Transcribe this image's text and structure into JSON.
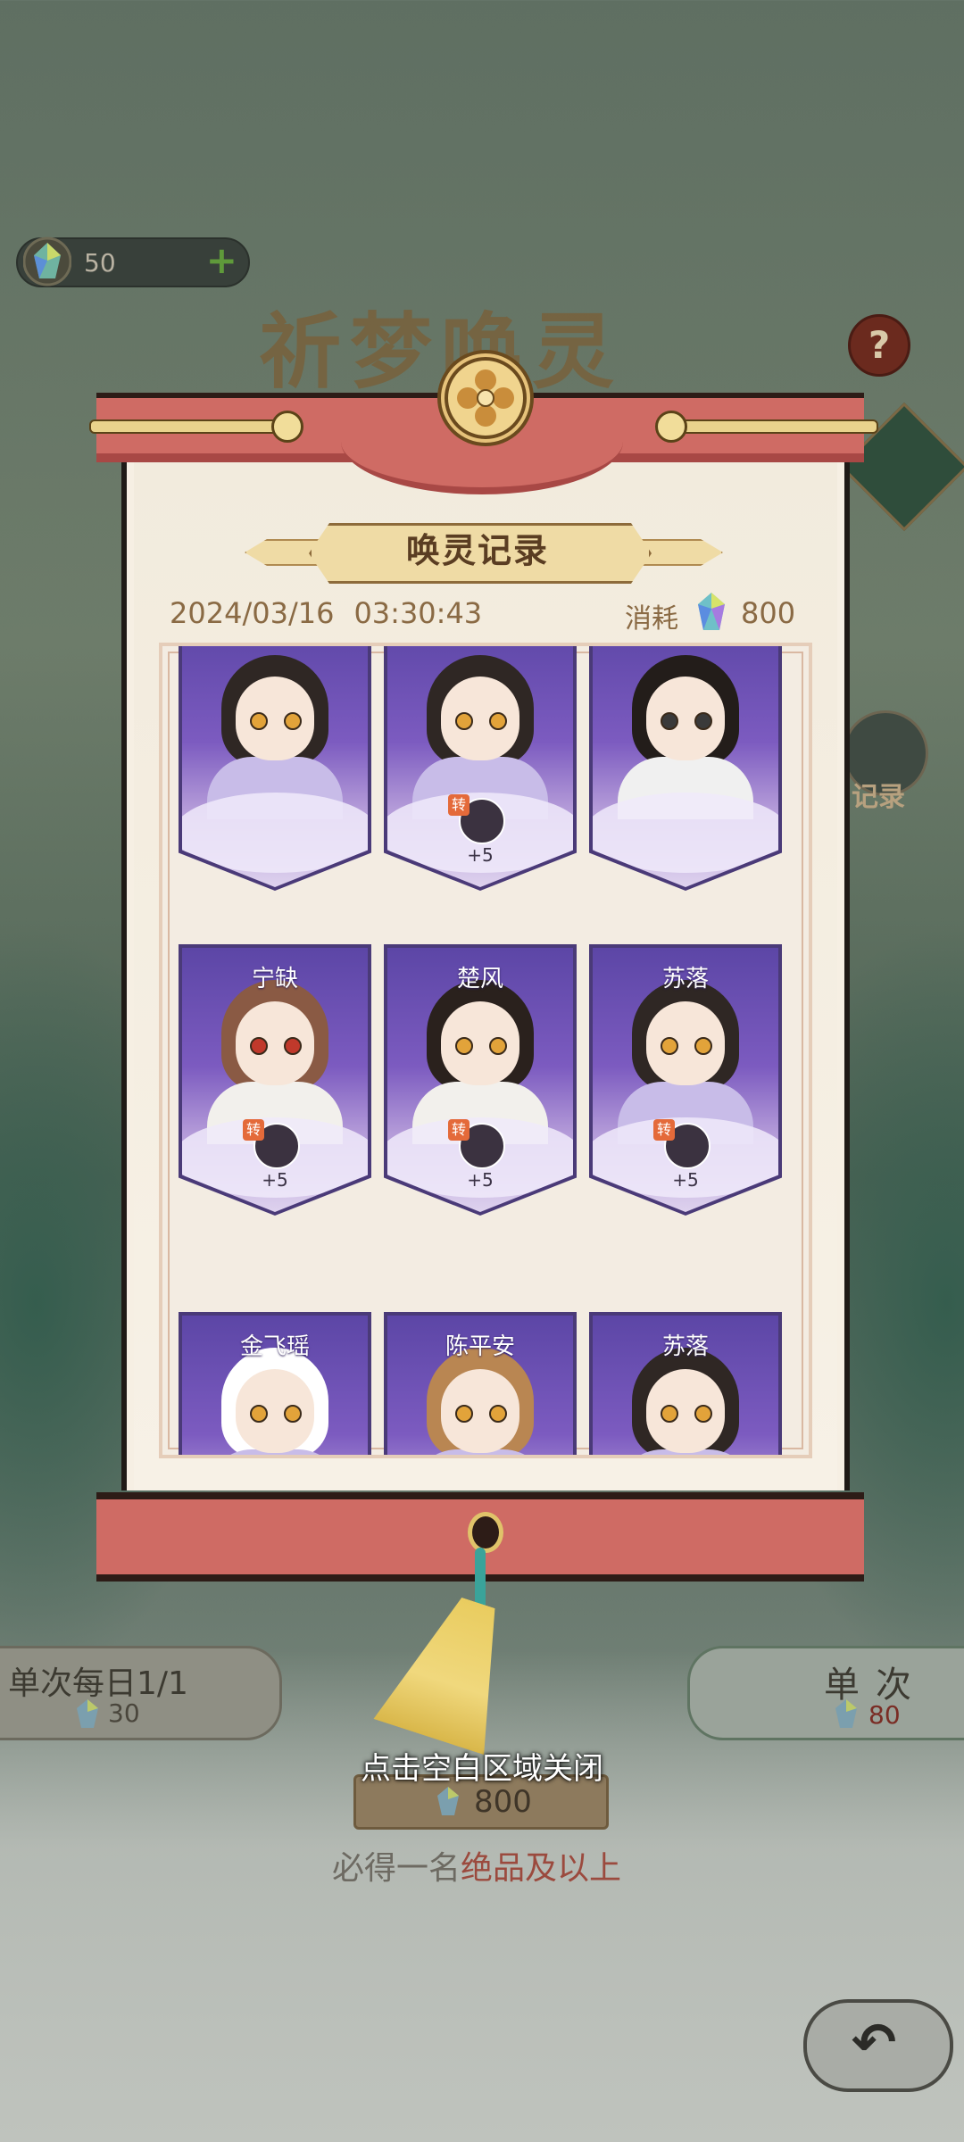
{
  "background": {
    "currency_value": "50",
    "currency_plus": "+",
    "title_text": "祈梦唤灵",
    "help_label": "?",
    "record_side_label": "记录",
    "single_daily": {
      "label": "单次每日1/1",
      "cost": "30"
    },
    "single": {
      "label": "单次",
      "cost": "80"
    },
    "ten_pull_cost": "800",
    "guarantee": {
      "prefix": "必得一名",
      "highlight": "绝品及以上"
    }
  },
  "dialog": {
    "title": "唤灵记录",
    "date": "2024/03/16",
    "time": "03:30:43",
    "cost_label": "消耗",
    "cost_value": "800",
    "cards": [
      {
        "name": "",
        "hair": "#2f2724",
        "eye": "#e2a33a",
        "robe": "#c8bce8",
        "transfer": false,
        "transfer_value": ""
      },
      {
        "name": "",
        "hair": "#2f2724",
        "eye": "#e2a33a",
        "robe": "#c8bce8",
        "transfer": true,
        "transfer_value": "+5"
      },
      {
        "name": "",
        "hair": "#231d1a",
        "eye": "#3a3a3a",
        "robe": "#f0f0f0",
        "transfer": false,
        "transfer_value": ""
      },
      {
        "name": "宁缺",
        "hair": "#8a5a44",
        "eye": "#c0392b",
        "robe": "#f2f0ec",
        "transfer": true,
        "transfer_value": "+5"
      },
      {
        "name": "楚风",
        "hair": "#2a211d",
        "eye": "#e2a33a",
        "robe": "#f2f0ec",
        "transfer": true,
        "transfer_value": "+5"
      },
      {
        "name": "苏落",
        "hair": "#2f2724",
        "eye": "#e2a33a",
        "robe": "#c8bce8",
        "transfer": true,
        "transfer_value": "+5"
      },
      {
        "name": "金飞瑶",
        "hair": "#ffffff",
        "eye": "#e2a33a",
        "robe": "#c8bce8",
        "transfer": false,
        "transfer_value": ""
      },
      {
        "name": "陈平安",
        "hair": "#b98652",
        "eye": "#e2a33a",
        "robe": "#c8bce8",
        "transfer": false,
        "transfer_value": ""
      },
      {
        "name": "苏落",
        "hair": "#2f2724",
        "eye": "#e2a33a",
        "robe": "#c8bce8",
        "transfer": false,
        "transfer_value": ""
      }
    ],
    "transfer_tag": "转",
    "close_hint": "点击空白区域关闭"
  },
  "colors": {
    "scroll_red": "#cf6b64",
    "card_purple": "#5c46a6",
    "gold": "#e6c27a"
  },
  "icons": {
    "currency": "jade-gem-icon",
    "help": "question-icon",
    "record": "scroll-record-icon",
    "back": "back-arrow-icon",
    "emblem": "flower-emblem-icon"
  }
}
